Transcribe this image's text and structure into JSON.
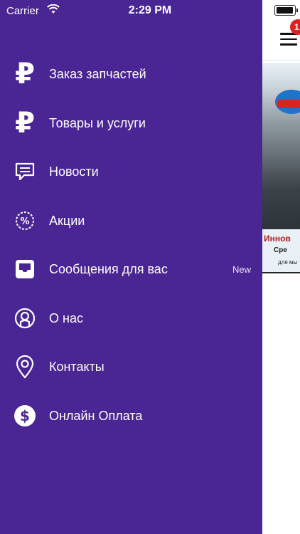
{
  "status_bar": {
    "carrier": "Carrier",
    "time": "2:29 PM"
  },
  "drawer": {
    "background": "#4a2594",
    "items": [
      {
        "label": "Заказ запчастей",
        "icon": "ruble-icon"
      },
      {
        "label": "Товары и услуги",
        "icon": "ruble-icon"
      },
      {
        "label": "Новости",
        "icon": "message-icon"
      },
      {
        "label": "Акции",
        "icon": "percent-badge-icon"
      },
      {
        "label": "Сообщения для вас",
        "icon": "inbox-icon",
        "badge": "New"
      },
      {
        "label": "О нас",
        "icon": "user-circle-icon"
      },
      {
        "label": "Контакты",
        "icon": "location-pin-icon"
      },
      {
        "label": "Онлайн Оплата",
        "icon": "dollar-circle-icon"
      }
    ]
  },
  "content": {
    "notification_count": "1",
    "banner": {
      "line1": "Иннов",
      "line2": "Сре",
      "line3": "для мы"
    }
  }
}
